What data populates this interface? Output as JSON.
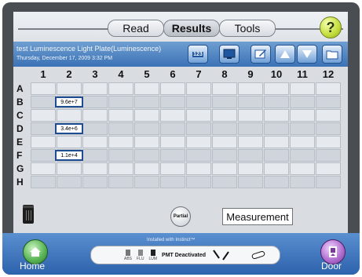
{
  "tabs": [
    {
      "label": "Read"
    },
    {
      "label": "Results"
    },
    {
      "label": "Tools"
    }
  ],
  "help": {
    "label": "?"
  },
  "header": {
    "plate_title": "test Luminescence Light Plate(Luminescence)",
    "date": "Thursday, December 17, 2009 3:32 PM",
    "toolbar_badge": "123"
  },
  "grid": {
    "columns": [
      "1",
      "2",
      "3",
      "4",
      "5",
      "6",
      "7",
      "8",
      "9",
      "10",
      "11",
      "12"
    ],
    "rows": [
      "A",
      "B",
      "C",
      "D",
      "E",
      "F",
      "G",
      "H"
    ],
    "values": [
      {
        "row": "B",
        "col": "2",
        "text": "9.6e+7"
      },
      {
        "row": "D",
        "col": "2",
        "text": "3.4e+6"
      },
      {
        "row": "F",
        "col": "2",
        "text": "1.1e+4"
      }
    ]
  },
  "controls": {
    "partial_label": "Partial",
    "measurement_label": "Measurement"
  },
  "bottom": {
    "installed_text": "Installed with Instinct™",
    "status_text": "PMT Deactivated",
    "modes": [
      "ABS",
      "FLU",
      "LUM"
    ],
    "home_label": "Home",
    "door_label": "Door"
  },
  "colors": {
    "accent_blue": "#3b72b6",
    "dark_frame": "#4a4e53",
    "home_green": "#5db758",
    "door_purple": "#b372d1",
    "help_yellow": "#c4dc3a"
  }
}
